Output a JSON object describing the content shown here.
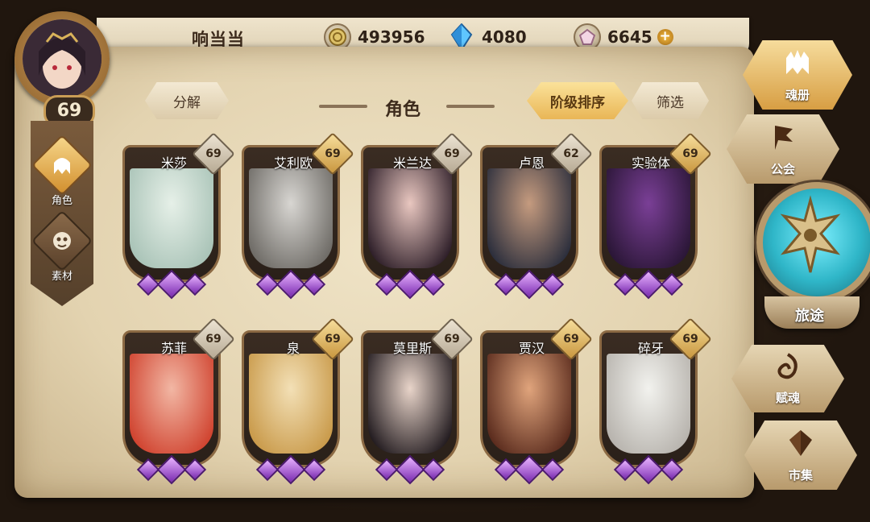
{
  "player": {
    "name": "响当当",
    "level": "69"
  },
  "resources": [
    {
      "icon": "gold-coin-icon",
      "value": "493956"
    },
    {
      "icon": "blue-crystal-icon",
      "value": "4080"
    },
    {
      "icon": "pink-gem-icon",
      "value": "6645"
    }
  ],
  "side_nav": [
    {
      "label": "角色",
      "icon": "character-helmet-icon",
      "active": true
    },
    {
      "label": "素材",
      "icon": "material-mask-icon",
      "active": false
    }
  ],
  "toolbar": {
    "decompose_label": "分解",
    "section_title": "角色",
    "sort_label": "阶级排序",
    "filter_label": "筛选"
  },
  "characters": [
    {
      "name": "米莎",
      "level": "69",
      "badge": "grey",
      "portrait": [
        "#e6f0e8",
        "#a9c3b7"
      ]
    },
    {
      "name": "艾利欧",
      "level": "69",
      "badge": "gold",
      "portrait": [
        "#d8d6d2",
        "#6e6b66"
      ]
    },
    {
      "name": "米兰达",
      "level": "69",
      "badge": "grey",
      "portrait": [
        "#e9c7c0",
        "#2e1f29"
      ]
    },
    {
      "name": "卢恩",
      "level": "62",
      "badge": "grey",
      "portrait": [
        "#c59b7f",
        "#2b2e3c"
      ]
    },
    {
      "name": "实验体",
      "level": "69",
      "badge": "gold",
      "portrait": [
        "#7a3f96",
        "#2a1636"
      ]
    },
    {
      "name": "苏菲",
      "level": "69",
      "badge": "grey",
      "portrait": [
        "#f2b7a4",
        "#d0432f"
      ]
    },
    {
      "name": "泉",
      "level": "69",
      "badge": "gold",
      "portrait": [
        "#f3e0b6",
        "#c99a4a"
      ]
    },
    {
      "name": "莫里斯",
      "level": "69",
      "badge": "grey",
      "portrait": [
        "#e8d4c9",
        "#231c20"
      ]
    },
    {
      "name": "贾汉",
      "level": "69",
      "badge": "gold",
      "portrait": [
        "#e0a47c",
        "#5a2b1d"
      ]
    },
    {
      "name": "碎牙",
      "level": "69",
      "badge": "gold",
      "portrait": [
        "#f2f2ee",
        "#b7b3ad"
      ]
    }
  ],
  "right_nav": [
    {
      "label": "魂册",
      "icon": "soul-book-icon",
      "active": true
    },
    {
      "label": "公会",
      "icon": "guild-banner-icon",
      "active": false
    },
    {
      "label": "旅途",
      "icon": "journey-emblem-icon",
      "active": false
    },
    {
      "label": "赋魂",
      "icon": "soul-swirl-icon",
      "active": false
    },
    {
      "label": "市集",
      "icon": "market-gem-icon",
      "active": false
    }
  ]
}
